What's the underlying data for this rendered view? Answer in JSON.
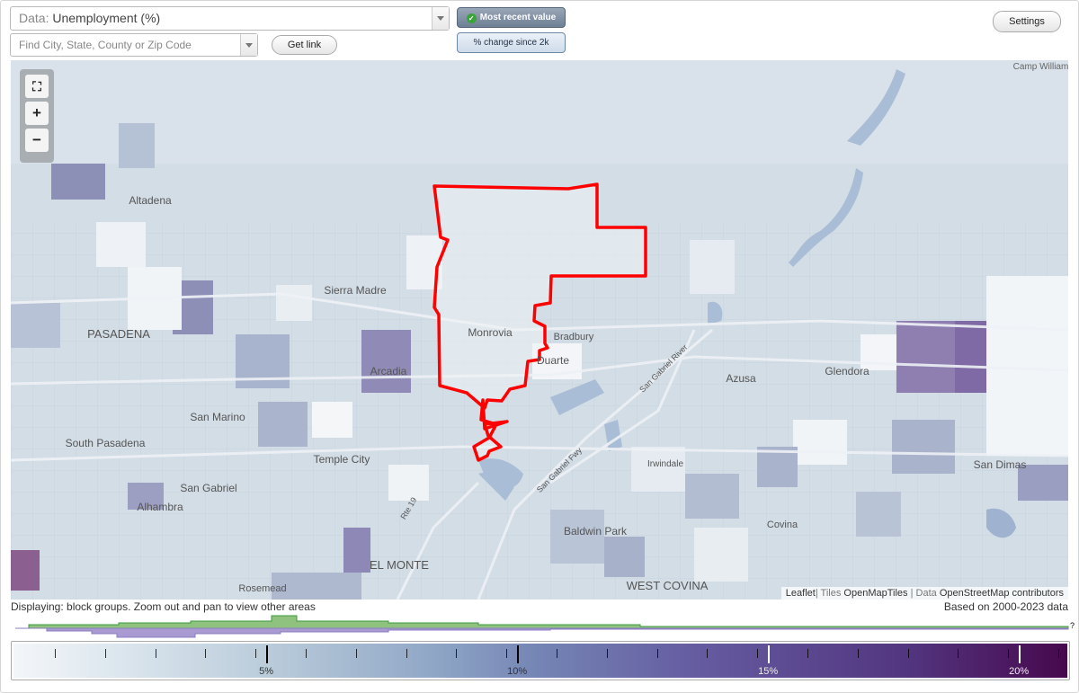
{
  "toolbar": {
    "data_label": "Data:",
    "data_value": "Unemployment (%)",
    "search_placeholder": "Find City, State, County or Zip Code",
    "get_link": "Get link",
    "most_recent": "Most recent value",
    "change_since": "% change since 2k",
    "settings": "Settings"
  },
  "map": {
    "controls": {
      "fit": "⛶",
      "zoom_in": "+",
      "zoom_out": "−"
    },
    "places": {
      "camp": "Camp Williams",
      "altadena": "Altadena",
      "sierra_madre": "Sierra Madre",
      "pasadena": "PASADENA",
      "monrovia": "Monrovia",
      "bradbury": "Bradbury",
      "duarte": "Duarte",
      "arcadia": "Arcadia",
      "azusa": "Azusa",
      "glendora": "Glendora",
      "san_marino": "San Marino",
      "south_pasadena": "South Pasadena",
      "temple_city": "Temple City",
      "irwindale": "Irwindale",
      "san_dimas": "San Dimas",
      "san_gabriel": "San Gabriel",
      "alhambra": "Alhambra",
      "baldwin_park": "Baldwin Park",
      "covina": "Covina",
      "el_monte": "EL MONTE",
      "rosemead": "Rosemead",
      "west_covina": "WEST COVINA",
      "san_gabriel_river": "San Gabriel River",
      "hwy_605": "San Gabriel Fwy",
      "hwy_19": "Rte 19"
    },
    "attribution": {
      "leaflet": "Leaflet",
      "tiles_pre": "| Tiles ",
      "tiles": "OpenMapTiles",
      "data_pre": " | Data ",
      "data": "OpenStreetMap contributors"
    },
    "colors": {
      "boundary": "#ff0000",
      "water": "#a9bdd6",
      "base": "#d3dde6"
    }
  },
  "footer": {
    "displaying": "Displaying: block groups. Zoom out and pan to view other areas",
    "based_on": "Based on 2000-2023 data",
    "question": "?"
  },
  "legend": {
    "labels": [
      "5%",
      "10%",
      "15%",
      "20%"
    ],
    "tick_positions_pct": [
      5,
      10,
      15,
      20
    ],
    "max_pct": 21
  }
}
